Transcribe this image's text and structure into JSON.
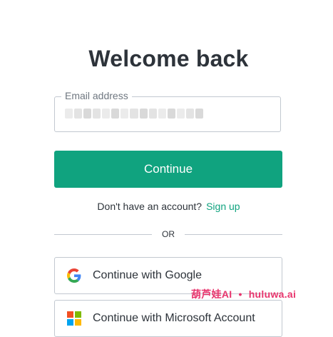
{
  "page": {
    "title": "Welcome back"
  },
  "email": {
    "label": "Email address",
    "value": "",
    "value_obscured": true
  },
  "continue_button": {
    "label": "Continue"
  },
  "signup": {
    "prompt": "Don't have an account?",
    "link": "Sign up"
  },
  "divider": {
    "label": "OR"
  },
  "social": [
    {
      "label": "Continue with Google",
      "icon": "google-icon"
    },
    {
      "label": "Continue with Microsoft Account",
      "icon": "microsoft-icon"
    }
  ],
  "watermark": {
    "brand": "葫芦娃AI",
    "separator": "•",
    "site": "huluwa.ai"
  },
  "colors": {
    "accent": "#10a37f",
    "text": "#2d333a",
    "border": "#c2c8d0",
    "watermark": "#e8356d"
  }
}
